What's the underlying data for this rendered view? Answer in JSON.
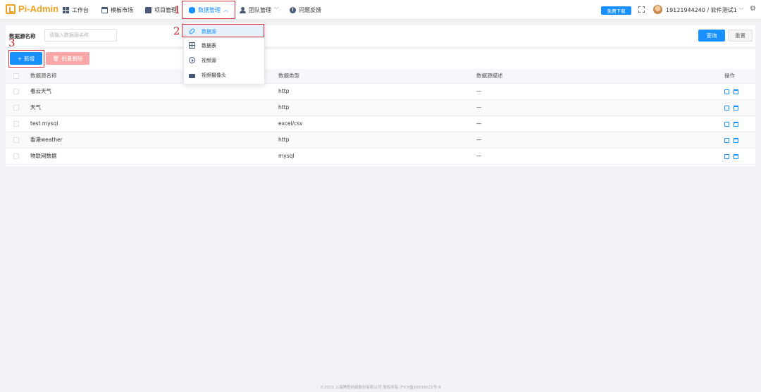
{
  "nav": {
    "logo": "Pi-Admin",
    "items": [
      {
        "label": "工作台"
      },
      {
        "label": "模板市场"
      },
      {
        "label": "项目管理"
      },
      {
        "label": "数据管理"
      },
      {
        "label": "团队管理"
      },
      {
        "label": "问题反馈"
      }
    ],
    "download_label": "免费下载",
    "user": "19121944240 / 软件测试1"
  },
  "dropdown": {
    "items": [
      {
        "label": "数据源"
      },
      {
        "label": "数据表"
      },
      {
        "label": "视频源"
      },
      {
        "label": "视频摄像头"
      }
    ]
  },
  "annotations": {
    "step1": "1",
    "step2": "2",
    "step3": "3"
  },
  "search": {
    "label": "数据源名称",
    "placeholder": "请输入数据源名称",
    "query_label": "查询",
    "reset_label": "重置"
  },
  "toolbar": {
    "add_label": "新增",
    "batch_delete_label": "批量删除"
  },
  "table": {
    "headers": [
      "数据源名称",
      "数据类型",
      "数据源描述",
      "操作"
    ],
    "rows": [
      {
        "name": "看云天气",
        "type": "http",
        "desc": "—"
      },
      {
        "name": "天气",
        "type": "http",
        "desc": "—"
      },
      {
        "name": "test mysql",
        "type": "excel/csv",
        "desc": "—"
      },
      {
        "name": "香港weather",
        "type": "http",
        "desc": "—"
      },
      {
        "name": "物联网数据",
        "type": "mysql",
        "desc": "—"
      }
    ]
  },
  "footer": "©2023  上海腾程网络股份有限公司 版权所有  沪ICP备16039022号-9",
  "colors": {
    "primary": "#1890ff",
    "brand": "#f0a020",
    "annotation_red": "#d9303a",
    "danger_light": "#f9a7a7"
  }
}
